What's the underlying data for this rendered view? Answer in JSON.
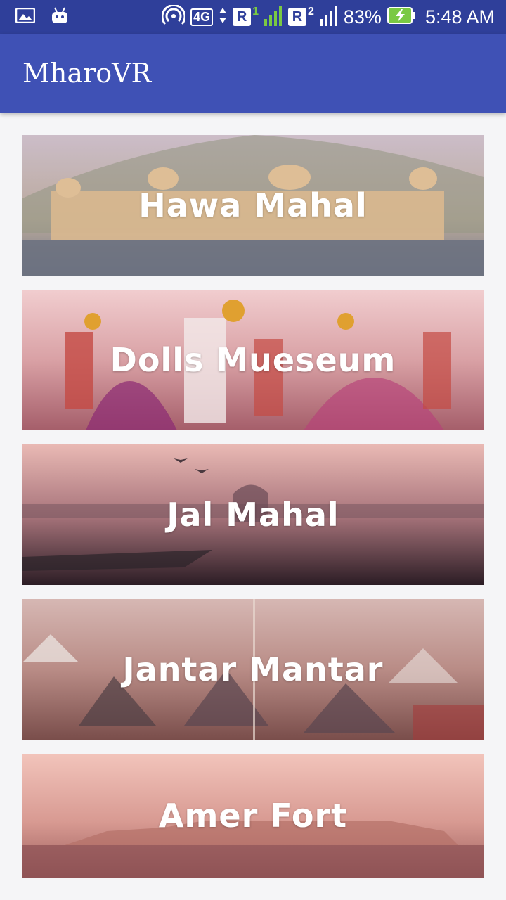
{
  "status_bar": {
    "network": "4G",
    "sim1_label": "R",
    "sim1_num": "1",
    "sim2_label": "R",
    "sim2_num": "2",
    "battery": "83%",
    "time": "5:48 AM"
  },
  "app_bar": {
    "title": "MharoVR"
  },
  "places": [
    {
      "name": "Hawa Mahal"
    },
    {
      "name": "Dolls Mueseum"
    },
    {
      "name": "Jal Mahal"
    },
    {
      "name": "Jantar Mantar"
    },
    {
      "name": "Amer Fort"
    }
  ],
  "colors": {
    "status_bar": "#2f3f9a",
    "app_bar": "#3f51b5",
    "background": "#f5f5f7",
    "battery_green": "#7ac943"
  }
}
